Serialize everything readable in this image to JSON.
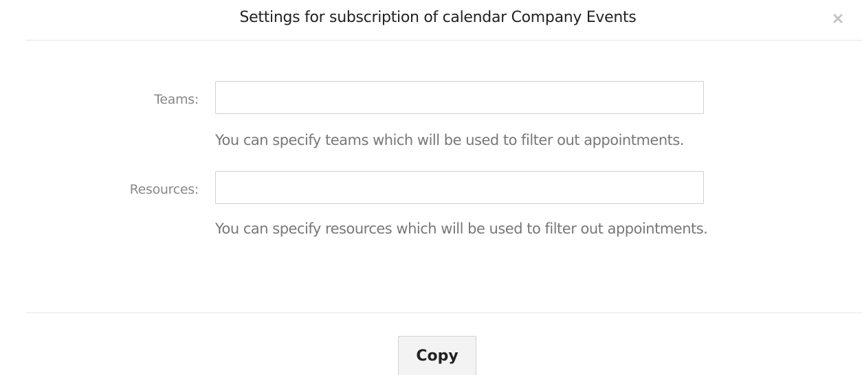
{
  "dialog": {
    "title": "Settings for subscription of calendar Company Events",
    "close_icon": "close-icon"
  },
  "form": {
    "teams": {
      "label": "Teams:",
      "value": "",
      "placeholder": "",
      "hint": "You can specify teams which will be used to filter out appointments."
    },
    "resources": {
      "label": "Resources:",
      "value": "",
      "placeholder": "",
      "hint": "You can specify resources which will be used to filter out appointments."
    }
  },
  "footer": {
    "copy_label": "Copy"
  },
  "colors": {
    "label": "#888888",
    "hint": "#777777",
    "border": "#cfcfcf",
    "button_bg": "#f3f3f3"
  }
}
